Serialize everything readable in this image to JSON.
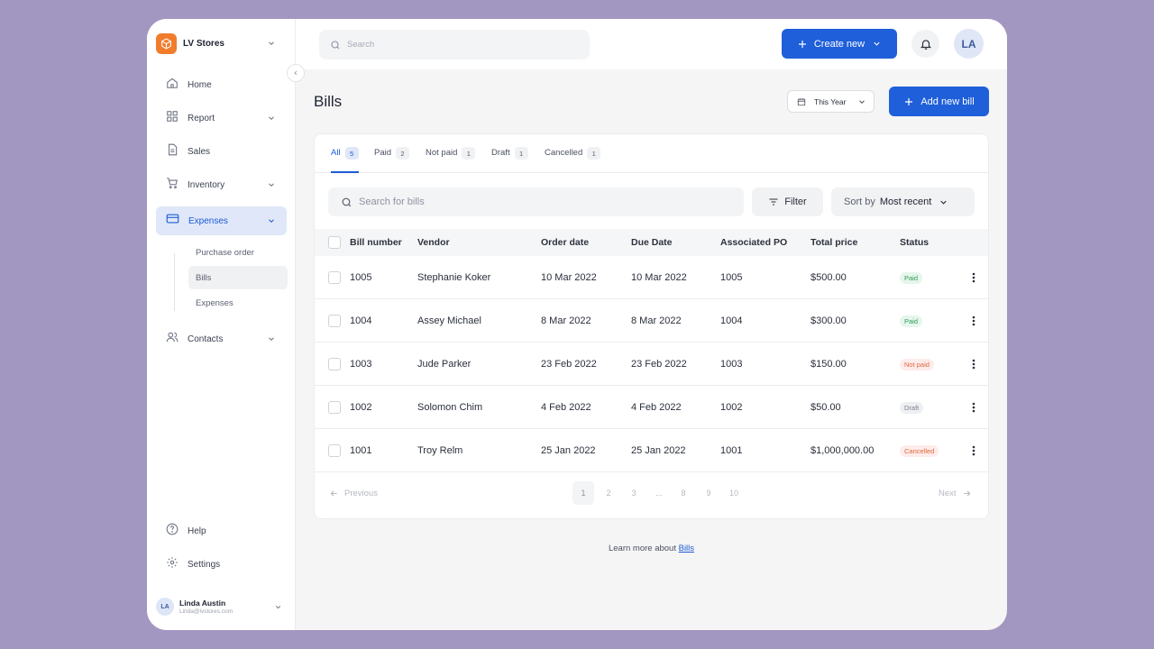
{
  "brand": {
    "name": "LV Stores"
  },
  "nav": {
    "home": "Home",
    "report": "Report",
    "sales": "Sales",
    "inventory": "Inventory",
    "expenses": "Expenses",
    "contacts": "Contacts",
    "help": "Help",
    "settings": "Settings"
  },
  "subnav": {
    "purchase_order": "Purchase order",
    "bills": "Bills",
    "expenses": "Expenses"
  },
  "user": {
    "initials": "LA",
    "name": "Linda Austin",
    "email": "Linda@lvstores.com"
  },
  "header": {
    "search_placeholder": "Search",
    "create_label": "Create new",
    "avatar_initials": "LA"
  },
  "page": {
    "title": "Bills",
    "period": "This Year",
    "add_label": "Add new bill"
  },
  "tabs": [
    {
      "label": "All",
      "count": "5"
    },
    {
      "label": "Paid",
      "count": "2"
    },
    {
      "label": "Not paid",
      "count": "1"
    },
    {
      "label": "Draft",
      "count": "1"
    },
    {
      "label": "Cancelled",
      "count": "1"
    }
  ],
  "toolbar": {
    "search_placeholder": "Search for bills",
    "filter_label": "Filter",
    "sort_prefix": "Sort by",
    "sort_value": "Most recent"
  },
  "table": {
    "headers": [
      "Bill number",
      "Vendor",
      "Order date",
      "Due Date",
      "Associated PO",
      "Total price",
      "Status"
    ],
    "rows": [
      {
        "bill": "1005",
        "vendor": "Stephanie Koker",
        "order": "10 Mar 2022",
        "due": "10 Mar 2022",
        "po": "1005",
        "price": "$500.00",
        "status": "Paid"
      },
      {
        "bill": "1004",
        "vendor": "Assey Michael",
        "order": "8 Mar 2022",
        "due": "8 Mar 2022",
        "po": "1004",
        "price": "$300.00",
        "status": "Paid"
      },
      {
        "bill": "1003",
        "vendor": "Jude Parker",
        "order": "23 Feb 2022",
        "due": "23 Feb 2022",
        "po": "1003",
        "price": "$150.00",
        "status": "Not paid"
      },
      {
        "bill": "1002",
        "vendor": "Solomon Chim",
        "order": "4 Feb 2022",
        "due": "4 Feb 2022",
        "po": "1002",
        "price": "$50.00",
        "status": "Draft"
      },
      {
        "bill": "1001",
        "vendor": "Troy Relm",
        "order": "25 Jan 2022",
        "due": "25 Jan 2022",
        "po": "1001",
        "price": "$1,000,000.00",
        "status": "Cancelled"
      }
    ]
  },
  "status_colors": {
    "Paid": {
      "bg": "#e6f6ec",
      "fg": "#2f9a5a"
    },
    "Not paid": {
      "bg": "#fdecea",
      "fg": "#e0683f"
    },
    "Draft": {
      "bg": "#eeeff1",
      "fg": "#7a808c"
    },
    "Cancelled": {
      "bg": "#fdecea",
      "fg": "#e0683f"
    }
  },
  "pagination": {
    "prev": "Previous",
    "next": "Next",
    "pages": [
      "1",
      "2",
      "3",
      "...",
      "8",
      "9",
      "10"
    ],
    "current": "1"
  },
  "footer": {
    "text": "Learn more about",
    "link": "Bills"
  },
  "colors": {
    "accent": "#1f5fd9",
    "brand": "#f07c2c",
    "background": "#a297c0"
  }
}
